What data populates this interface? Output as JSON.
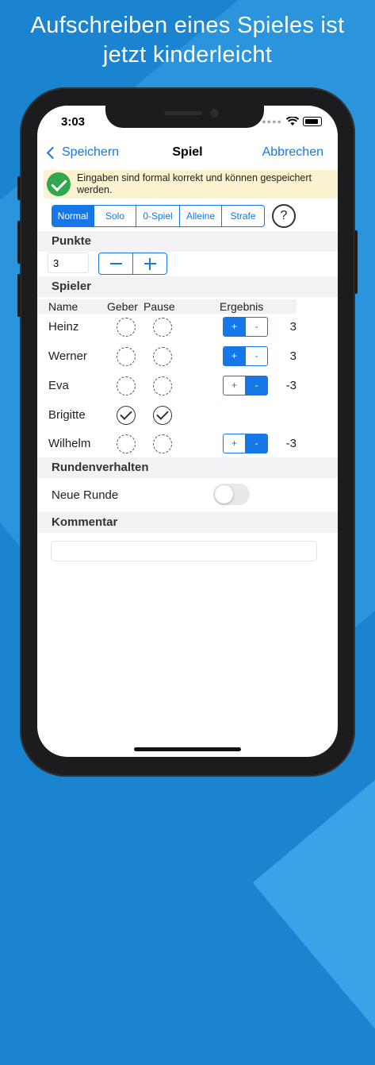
{
  "headline": {
    "line1": "Aufschreiben eines Spieles ist",
    "line2": "jetzt kinderleicht"
  },
  "status_bar": {
    "time": "3:03"
  },
  "nav": {
    "back_label": "Speichern",
    "title": "Spiel",
    "cancel_label": "Abbrechen"
  },
  "banner": {
    "text": "Eingaben sind formal korrekt und können gespeichert werden.",
    "icon": "check-circle-icon"
  },
  "game_types": {
    "options": [
      "Normal",
      "Solo",
      "0-Spiel",
      "Alleine",
      "Strafe"
    ],
    "selected": "Normal",
    "help_label": "?"
  },
  "points": {
    "section_title": "Punkte",
    "value": "3",
    "minus_label": "−",
    "plus_label": "+"
  },
  "players": {
    "section_title": "Spieler",
    "columns": {
      "name": "Name",
      "dealer": "Geber",
      "pause": "Pause",
      "result": "Ergebnis"
    },
    "rows": [
      {
        "name": "Heinz",
        "dealer": false,
        "pause": false,
        "plus_active": true,
        "result": "3"
      },
      {
        "name": "Werner",
        "dealer": false,
        "pause": false,
        "plus_active": true,
        "result": "3"
      },
      {
        "name": "Eva",
        "dealer": false,
        "pause": false,
        "plus_active": false,
        "result": "-3"
      },
      {
        "name": "Brigitte",
        "dealer": true,
        "pause": true,
        "plus_active": null,
        "result": ""
      },
      {
        "name": "Wilhelm",
        "dealer": false,
        "pause": false,
        "plus_active": false,
        "result": "-3"
      }
    ],
    "plus_label": "+",
    "minus_label": "-"
  },
  "round": {
    "section_title": "Rundenverhalten",
    "new_round_label": "Neue Runde",
    "new_round_on": false
  },
  "comment": {
    "section_title": "Kommentar",
    "value": ""
  },
  "colors": {
    "accent": "#1677e6",
    "background": "#1a84d0",
    "banner": "#fbf2cf",
    "success": "#2fa84f"
  }
}
